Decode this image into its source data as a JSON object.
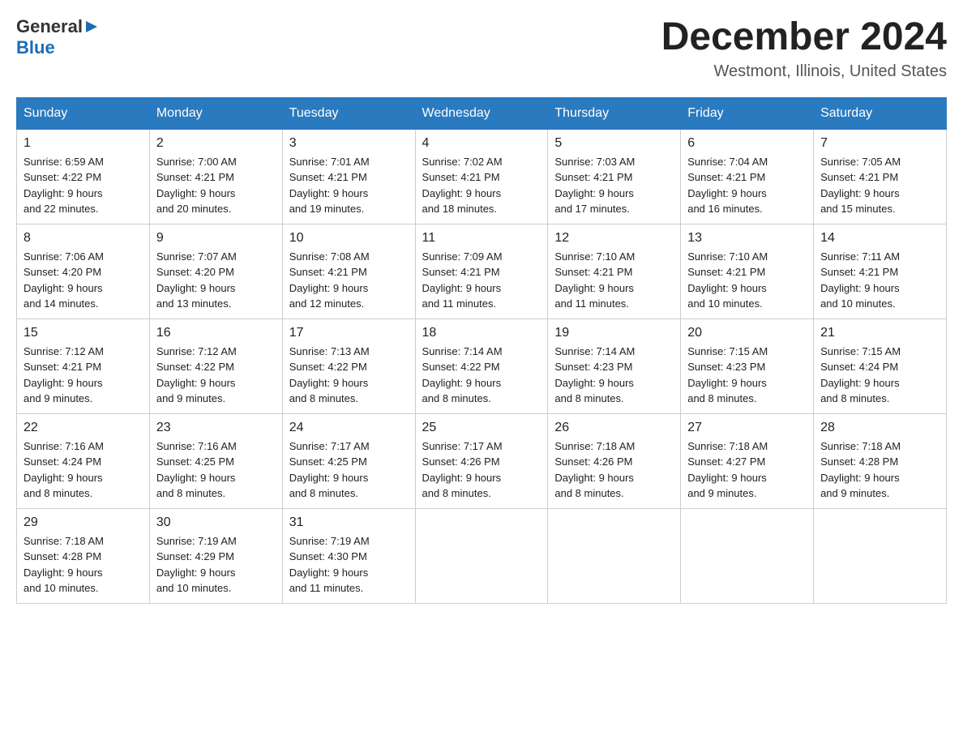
{
  "header": {
    "logo": {
      "general": "General",
      "blue": "Blue"
    },
    "title": "December 2024",
    "location": "Westmont, Illinois, United States"
  },
  "days_of_week": [
    "Sunday",
    "Monday",
    "Tuesday",
    "Wednesday",
    "Thursday",
    "Friday",
    "Saturday"
  ],
  "weeks": [
    [
      {
        "day": "1",
        "sunrise": "6:59 AM",
        "sunset": "4:22 PM",
        "daylight": "9 hours and 22 minutes."
      },
      {
        "day": "2",
        "sunrise": "7:00 AM",
        "sunset": "4:21 PM",
        "daylight": "9 hours and 20 minutes."
      },
      {
        "day": "3",
        "sunrise": "7:01 AM",
        "sunset": "4:21 PM",
        "daylight": "9 hours and 19 minutes."
      },
      {
        "day": "4",
        "sunrise": "7:02 AM",
        "sunset": "4:21 PM",
        "daylight": "9 hours and 18 minutes."
      },
      {
        "day": "5",
        "sunrise": "7:03 AM",
        "sunset": "4:21 PM",
        "daylight": "9 hours and 17 minutes."
      },
      {
        "day": "6",
        "sunrise": "7:04 AM",
        "sunset": "4:21 PM",
        "daylight": "9 hours and 16 minutes."
      },
      {
        "day": "7",
        "sunrise": "7:05 AM",
        "sunset": "4:21 PM",
        "daylight": "9 hours and 15 minutes."
      }
    ],
    [
      {
        "day": "8",
        "sunrise": "7:06 AM",
        "sunset": "4:20 PM",
        "daylight": "9 hours and 14 minutes."
      },
      {
        "day": "9",
        "sunrise": "7:07 AM",
        "sunset": "4:20 PM",
        "daylight": "9 hours and 13 minutes."
      },
      {
        "day": "10",
        "sunrise": "7:08 AM",
        "sunset": "4:21 PM",
        "daylight": "9 hours and 12 minutes."
      },
      {
        "day": "11",
        "sunrise": "7:09 AM",
        "sunset": "4:21 PM",
        "daylight": "9 hours and 11 minutes."
      },
      {
        "day": "12",
        "sunrise": "7:10 AM",
        "sunset": "4:21 PM",
        "daylight": "9 hours and 11 minutes."
      },
      {
        "day": "13",
        "sunrise": "7:10 AM",
        "sunset": "4:21 PM",
        "daylight": "9 hours and 10 minutes."
      },
      {
        "day": "14",
        "sunrise": "7:11 AM",
        "sunset": "4:21 PM",
        "daylight": "9 hours and 10 minutes."
      }
    ],
    [
      {
        "day": "15",
        "sunrise": "7:12 AM",
        "sunset": "4:21 PM",
        "daylight": "9 hours and 9 minutes."
      },
      {
        "day": "16",
        "sunrise": "7:12 AM",
        "sunset": "4:22 PM",
        "daylight": "9 hours and 9 minutes."
      },
      {
        "day": "17",
        "sunrise": "7:13 AM",
        "sunset": "4:22 PM",
        "daylight": "9 hours and 8 minutes."
      },
      {
        "day": "18",
        "sunrise": "7:14 AM",
        "sunset": "4:22 PM",
        "daylight": "9 hours and 8 minutes."
      },
      {
        "day": "19",
        "sunrise": "7:14 AM",
        "sunset": "4:23 PM",
        "daylight": "9 hours and 8 minutes."
      },
      {
        "day": "20",
        "sunrise": "7:15 AM",
        "sunset": "4:23 PM",
        "daylight": "9 hours and 8 minutes."
      },
      {
        "day": "21",
        "sunrise": "7:15 AM",
        "sunset": "4:24 PM",
        "daylight": "9 hours and 8 minutes."
      }
    ],
    [
      {
        "day": "22",
        "sunrise": "7:16 AM",
        "sunset": "4:24 PM",
        "daylight": "9 hours and 8 minutes."
      },
      {
        "day": "23",
        "sunrise": "7:16 AM",
        "sunset": "4:25 PM",
        "daylight": "9 hours and 8 minutes."
      },
      {
        "day": "24",
        "sunrise": "7:17 AM",
        "sunset": "4:25 PM",
        "daylight": "9 hours and 8 minutes."
      },
      {
        "day": "25",
        "sunrise": "7:17 AM",
        "sunset": "4:26 PM",
        "daylight": "9 hours and 8 minutes."
      },
      {
        "day": "26",
        "sunrise": "7:18 AM",
        "sunset": "4:26 PM",
        "daylight": "9 hours and 8 minutes."
      },
      {
        "day": "27",
        "sunrise": "7:18 AM",
        "sunset": "4:27 PM",
        "daylight": "9 hours and 9 minutes."
      },
      {
        "day": "28",
        "sunrise": "7:18 AM",
        "sunset": "4:28 PM",
        "daylight": "9 hours and 9 minutes."
      }
    ],
    [
      {
        "day": "29",
        "sunrise": "7:18 AM",
        "sunset": "4:28 PM",
        "daylight": "9 hours and 10 minutes."
      },
      {
        "day": "30",
        "sunrise": "7:19 AM",
        "sunset": "4:29 PM",
        "daylight": "9 hours and 10 minutes."
      },
      {
        "day": "31",
        "sunrise": "7:19 AM",
        "sunset": "4:30 PM",
        "daylight": "9 hours and 11 minutes."
      },
      null,
      null,
      null,
      null
    ]
  ],
  "labels": {
    "sunrise": "Sunrise:",
    "sunset": "Sunset:",
    "daylight": "Daylight:"
  }
}
